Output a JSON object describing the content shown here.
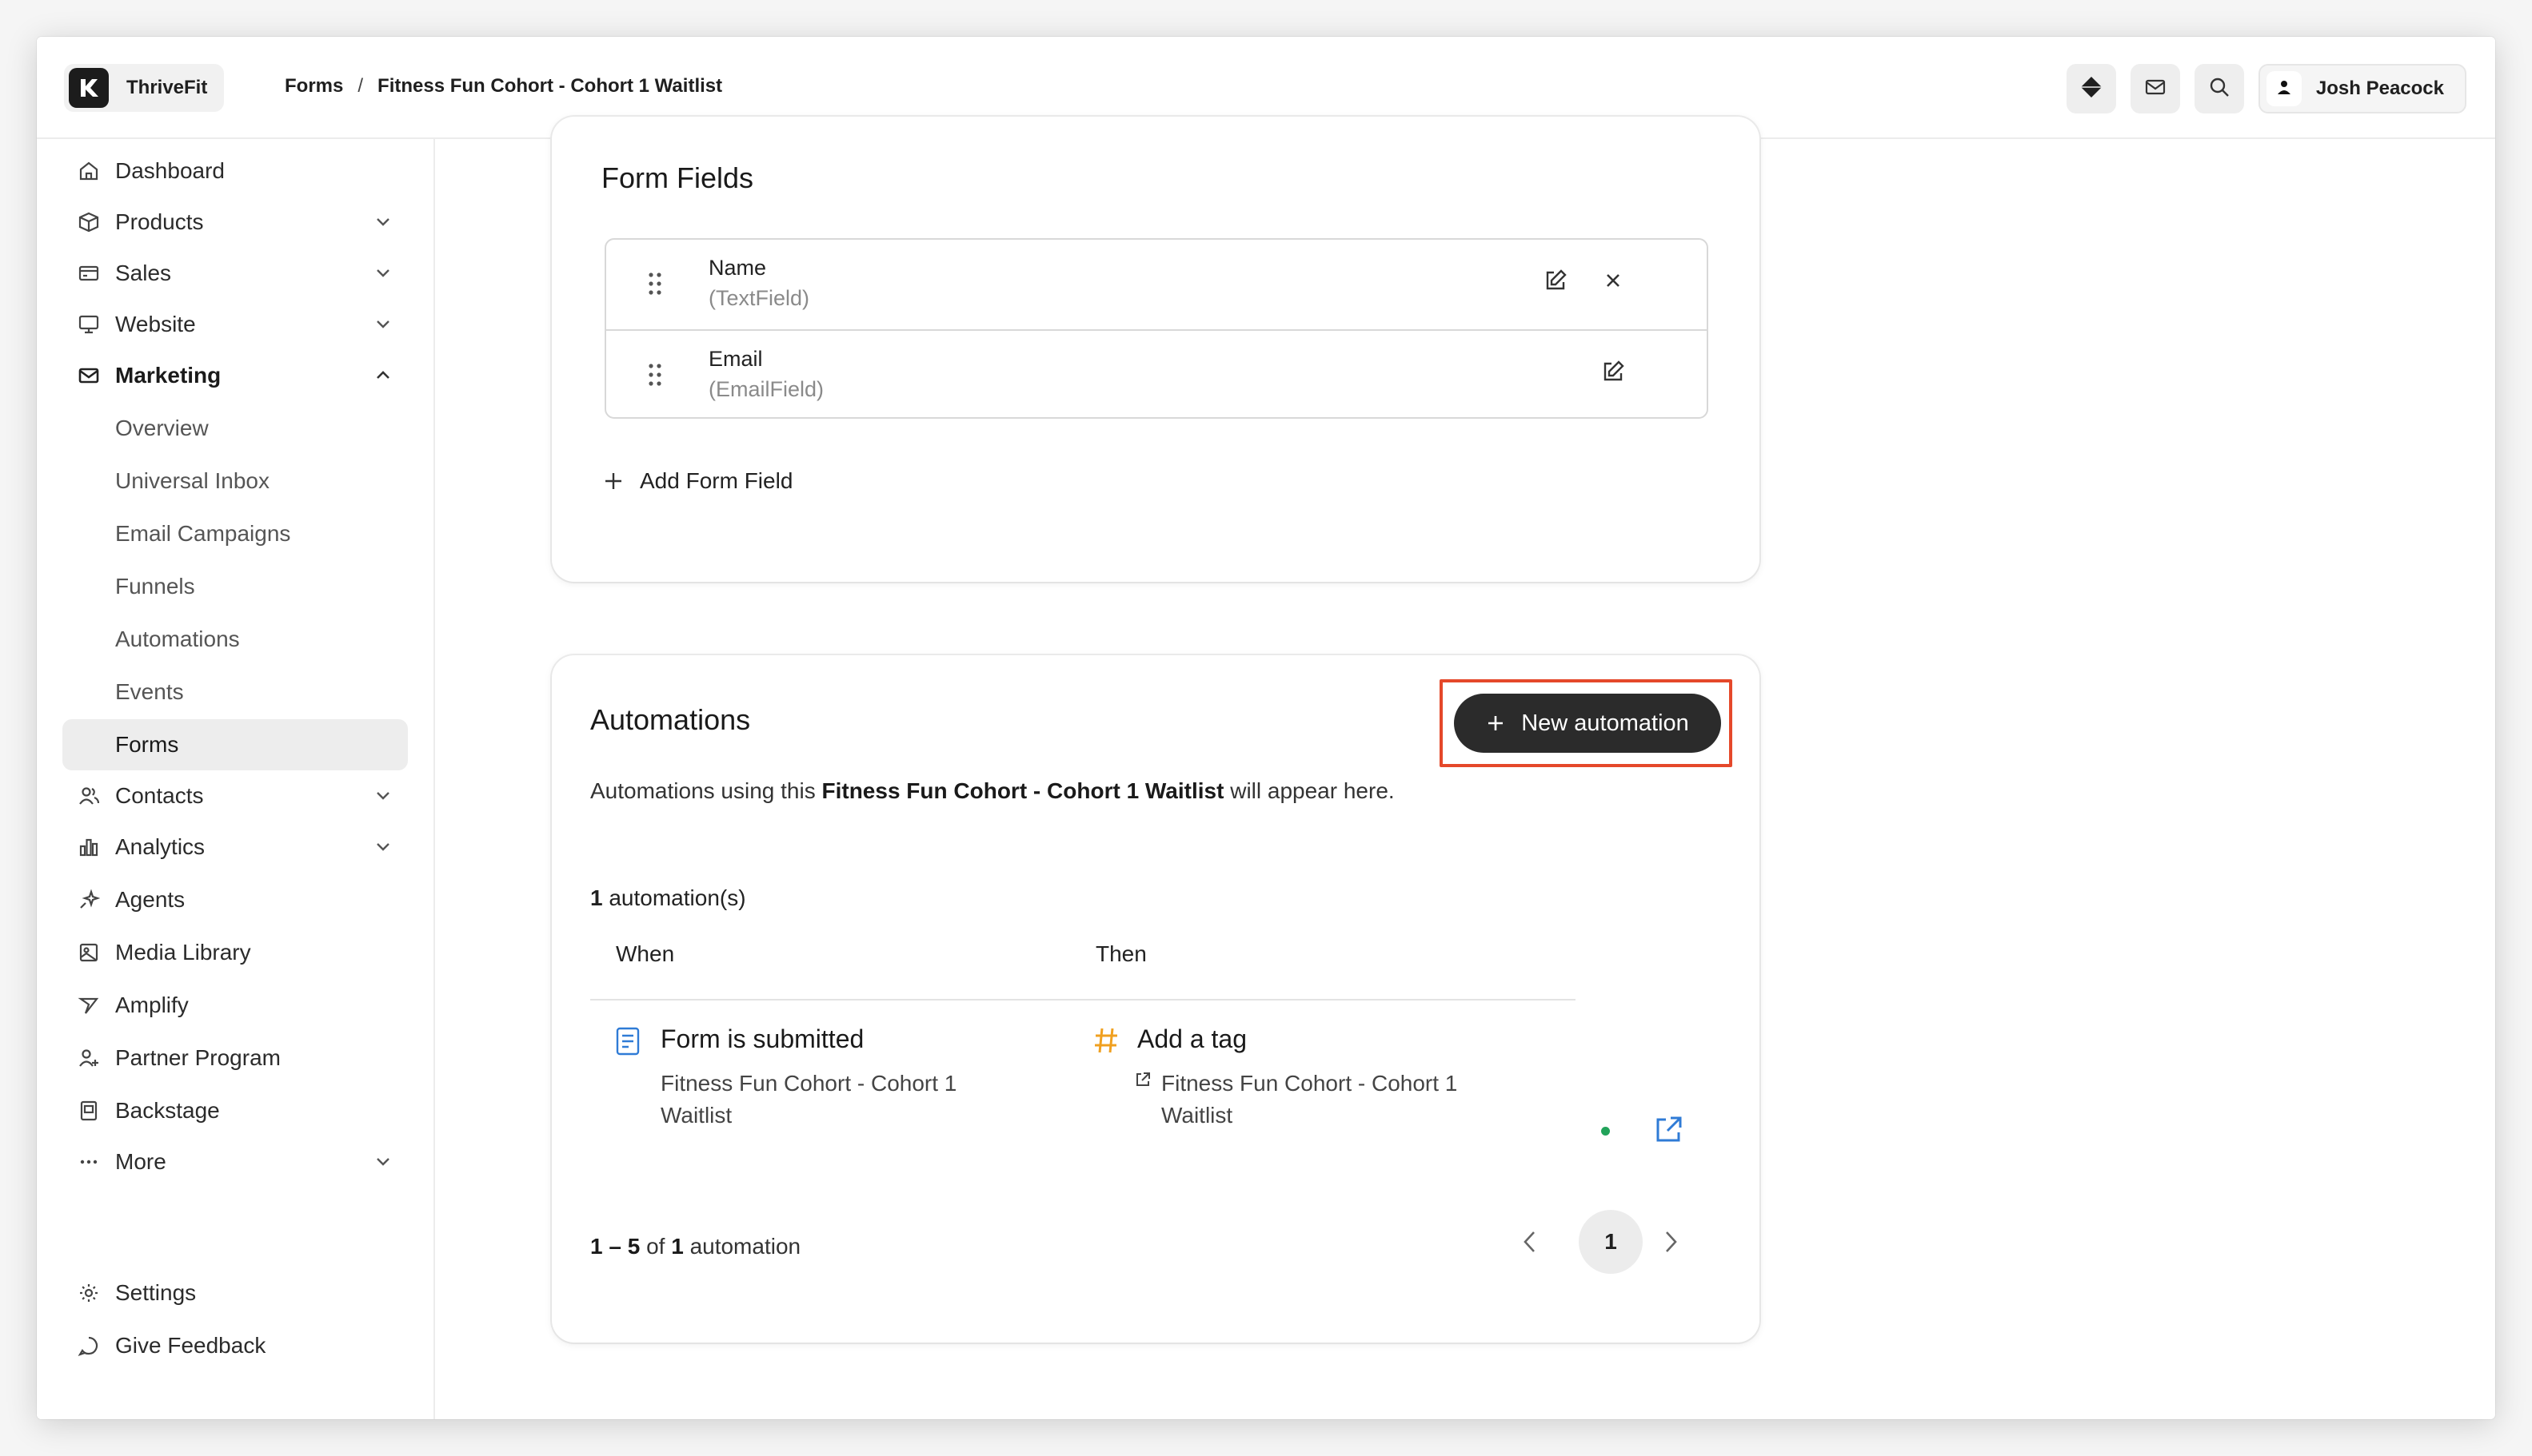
{
  "app": {
    "name": "ThriveFit"
  },
  "breadcrumb": {
    "parent": "Forms",
    "separator": "/",
    "current": "Fitness Fun Cohort - Cohort 1 Waitlist"
  },
  "user": {
    "name": "Josh Peacock"
  },
  "sidebar": {
    "items": [
      {
        "label": "Dashboard",
        "icon": "home-icon"
      },
      {
        "label": "Products",
        "icon": "box-icon",
        "expandable": true
      },
      {
        "label": "Sales",
        "icon": "credit-card-icon",
        "expandable": true
      },
      {
        "label": "Website",
        "icon": "monitor-icon",
        "expandable": true
      },
      {
        "label": "Marketing",
        "icon": "mail-icon",
        "expanded": true
      },
      {
        "label": "Contacts",
        "icon": "users-icon",
        "expandable": true
      },
      {
        "label": "Analytics",
        "icon": "bar-chart-icon",
        "expandable": true
      },
      {
        "label": "Agents",
        "icon": "sparkles-icon"
      },
      {
        "label": "Media Library",
        "icon": "image-icon"
      },
      {
        "label": "Amplify",
        "icon": "amplify-icon"
      },
      {
        "label": "Partner Program",
        "icon": "user-plus-icon"
      },
      {
        "label": "Backstage",
        "icon": "backstage-icon"
      },
      {
        "label": "More",
        "icon": "more-icon",
        "expandable": true
      }
    ],
    "marketing_sub": [
      "Overview",
      "Universal Inbox",
      "Email Campaigns",
      "Funnels",
      "Automations",
      "Events",
      "Forms"
    ],
    "active_sub": "Forms",
    "footer": [
      {
        "label": "Settings",
        "icon": "gear-icon"
      },
      {
        "label": "Give Feedback",
        "icon": "chat-icon"
      }
    ]
  },
  "form_fields": {
    "title": "Form Fields",
    "fields": [
      {
        "name": "Name",
        "type": "(TextField)"
      },
      {
        "name": "Email",
        "type": "(EmailField)"
      }
    ],
    "add_label": "Add Form Field"
  },
  "automations": {
    "title": "Automations",
    "new_button": "New automation",
    "desc_prefix": "Automations using this",
    "desc_form": "Fitness Fun Cohort - Cohort 1 Waitlist",
    "desc_suffix": "will appear here.",
    "count_num": "1",
    "count_label": "automation(s)",
    "col_when": "When",
    "col_then": "Then",
    "rows": [
      {
        "when_title": "Form is submitted",
        "when_sub": "Fitness Fun Cohort - Cohort 1 Waitlist",
        "then_title": "Add a tag",
        "then_sub": "Fitness Fun Cohort - Cohort 1 Waitlist",
        "status": "active"
      }
    ],
    "pager_range": "1 – 5",
    "pager_of": "of",
    "pager_total": "1",
    "pager_unit": "automation",
    "current_page": "1"
  },
  "colors": {
    "accent": "#2b2b2b",
    "highlight": "#e5482a",
    "status_active": "#22a35a",
    "link": "#2f7bd6",
    "tag": "#f0a020"
  }
}
